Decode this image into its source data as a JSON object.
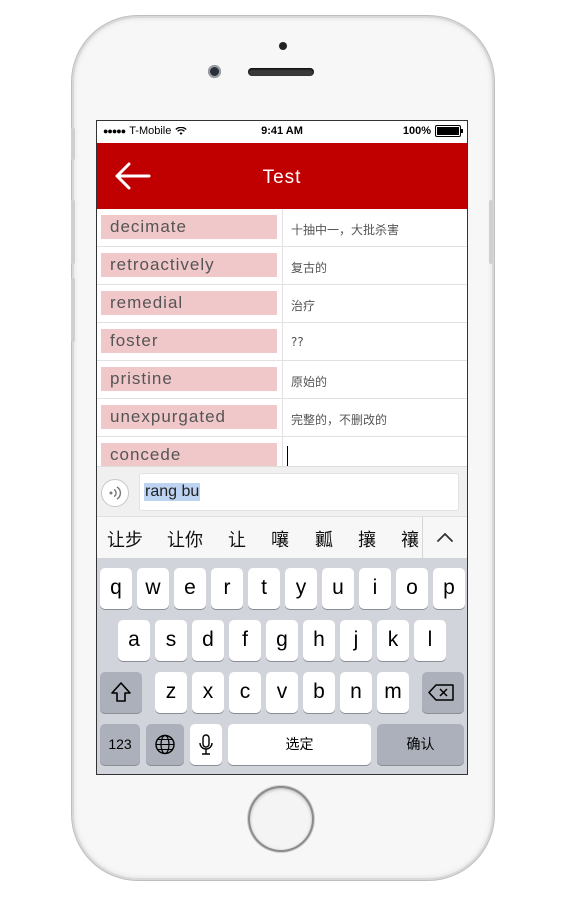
{
  "status_bar": {
    "carrier": "T-Mobile",
    "time": "9:41 AM",
    "battery": "100%"
  },
  "header": {
    "title": "Test",
    "back_icon": "arrow-left-icon",
    "color": "#c00000"
  },
  "rows": [
    {
      "word": "decimate",
      "meaning": "十抽中一，大批杀害"
    },
    {
      "word": "retroactively",
      "meaning": "复古的"
    },
    {
      "word": "remedial",
      "meaning": "治疗"
    },
    {
      "word": "foster",
      "meaning": "??"
    },
    {
      "word": "pristine",
      "meaning": "原始的"
    },
    {
      "word": "unexpurgated",
      "meaning": "完整的，不删改的"
    },
    {
      "word": "concede",
      "meaning": ""
    }
  ],
  "ime": {
    "composition": "rang bu",
    "candidates": [
      "让步",
      "让你",
      "让",
      "嚷",
      "瓤",
      "攘",
      "禳"
    ]
  },
  "keyboard": {
    "row1": [
      "q",
      "w",
      "e",
      "r",
      "t",
      "y",
      "u",
      "i",
      "o",
      "p"
    ],
    "row2": [
      "a",
      "s",
      "d",
      "f",
      "g",
      "h",
      "j",
      "k",
      "l"
    ],
    "row3": [
      "z",
      "x",
      "c",
      "v",
      "b",
      "n",
      "m"
    ],
    "numbers_label": "123",
    "space_label": "选定",
    "return_label": "确认"
  },
  "colors": {
    "accent": "#c00000",
    "word_highlight": "#f1c8ca"
  }
}
